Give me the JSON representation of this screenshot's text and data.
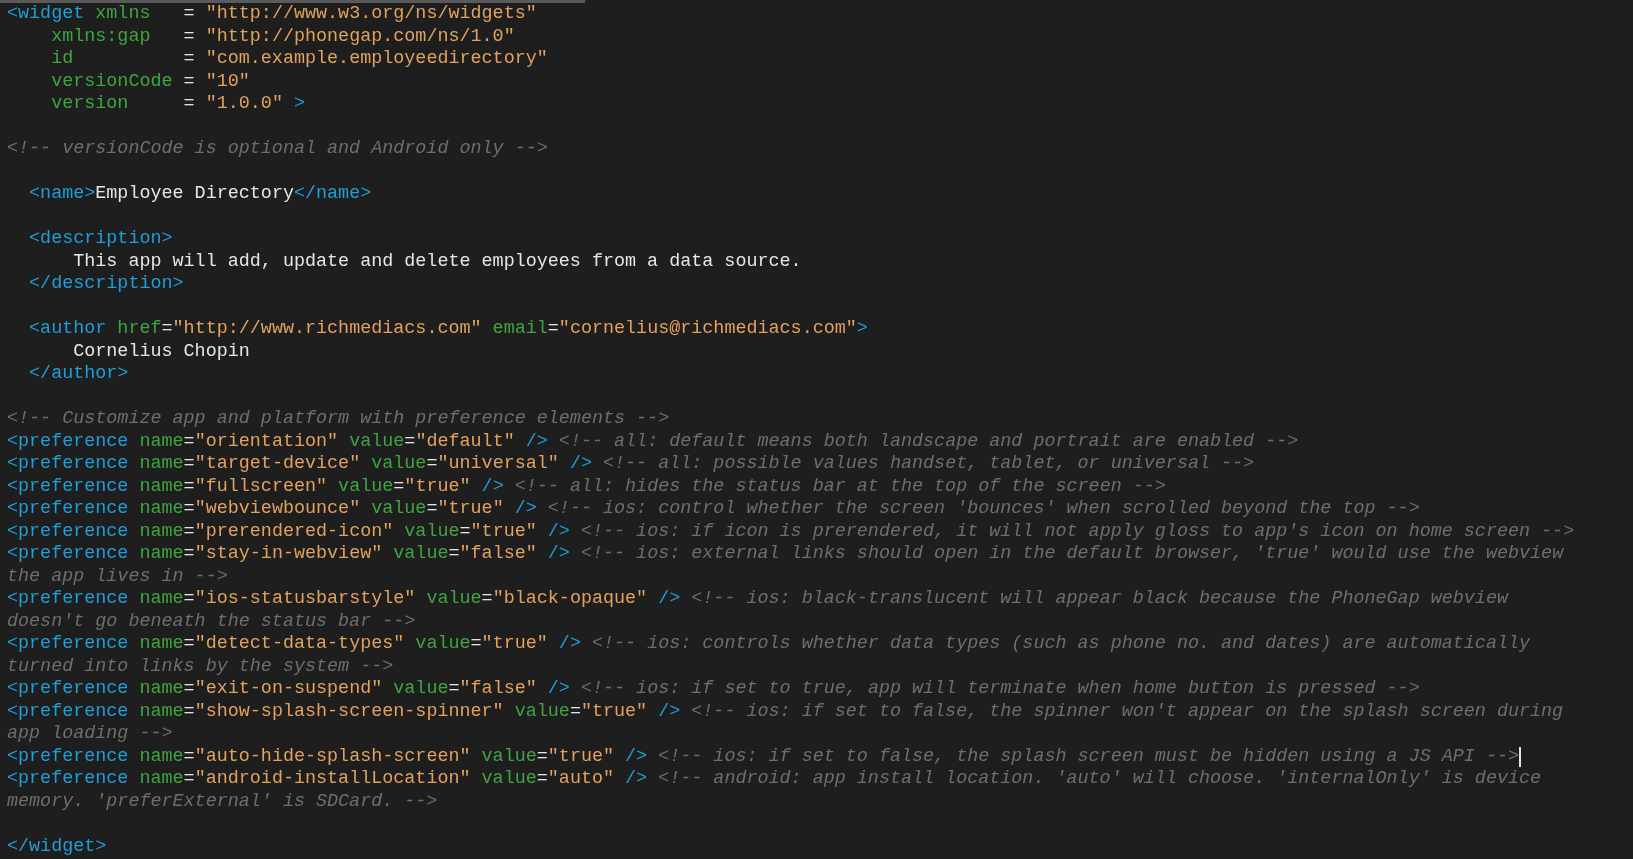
{
  "editor": {
    "lines": [
      {
        "kind": "code",
        "tokens": [
          {
            "kind": "tag",
            "text": "<widget"
          },
          {
            "kind": "attr",
            "text": " xmlns"
          },
          {
            "kind": "text",
            "text": "   = "
          },
          {
            "kind": "string",
            "text": "\"http://www.w3.org/ns/widgets\""
          }
        ]
      },
      {
        "kind": "code",
        "tokens": [
          {
            "kind": "attr",
            "text": "    xmlns:gap"
          },
          {
            "kind": "text",
            "text": "   = "
          },
          {
            "kind": "string",
            "text": "\"http://phonegap.com/ns/1.0\""
          }
        ]
      },
      {
        "kind": "code",
        "tokens": [
          {
            "kind": "attr",
            "text": "    id"
          },
          {
            "kind": "text",
            "text": "          = "
          },
          {
            "kind": "string",
            "text": "\"com.example.employeedirectory\""
          }
        ]
      },
      {
        "kind": "code",
        "tokens": [
          {
            "kind": "attr",
            "text": "    versionCode"
          },
          {
            "kind": "text",
            "text": " = "
          },
          {
            "kind": "string",
            "text": "\"10\""
          }
        ]
      },
      {
        "kind": "code",
        "tokens": [
          {
            "kind": "attr",
            "text": "    version"
          },
          {
            "kind": "text",
            "text": "     = "
          },
          {
            "kind": "string",
            "text": "\"1.0.0\""
          },
          {
            "kind": "tag",
            "text": " >"
          }
        ]
      },
      {
        "kind": "blank"
      },
      {
        "kind": "code",
        "tokens": [
          {
            "kind": "comment",
            "text": "<!-- versionCode is optional and Android only -->"
          }
        ]
      },
      {
        "kind": "blank"
      },
      {
        "kind": "code",
        "tokens": [
          {
            "kind": "tag",
            "text": "  <name>"
          },
          {
            "kind": "text",
            "text": "Employee Directory"
          },
          {
            "kind": "tag",
            "text": "</name>"
          }
        ]
      },
      {
        "kind": "blank"
      },
      {
        "kind": "code",
        "tokens": [
          {
            "kind": "tag",
            "text": "  <description>"
          }
        ]
      },
      {
        "kind": "code",
        "tokens": [
          {
            "kind": "text",
            "text": "      This app will add, update and delete employees from a data source."
          }
        ]
      },
      {
        "kind": "code",
        "tokens": [
          {
            "kind": "tag",
            "text": "  </description>"
          }
        ]
      },
      {
        "kind": "blank"
      },
      {
        "kind": "code",
        "tokens": [
          {
            "kind": "tag",
            "text": "  <author"
          },
          {
            "kind": "attr",
            "text": " href"
          },
          {
            "kind": "text",
            "text": "="
          },
          {
            "kind": "string",
            "text": "\"http://www.richmediacs.com\""
          },
          {
            "kind": "attr",
            "text": " email"
          },
          {
            "kind": "text",
            "text": "="
          },
          {
            "kind": "string",
            "text": "\"cornelius@richmediacs.com\""
          },
          {
            "kind": "tag",
            "text": ">"
          }
        ]
      },
      {
        "kind": "code",
        "tokens": [
          {
            "kind": "text",
            "text": "      Cornelius Chopin"
          }
        ]
      },
      {
        "kind": "code",
        "tokens": [
          {
            "kind": "tag",
            "text": "  </author>"
          }
        ]
      },
      {
        "kind": "blank"
      },
      {
        "kind": "code",
        "tokens": [
          {
            "kind": "comment",
            "text": "<!-- Customize app and platform with preference elements -->"
          }
        ]
      },
      {
        "kind": "code",
        "tokens": [
          {
            "kind": "tag",
            "text": "<preference"
          },
          {
            "kind": "attr",
            "text": " name"
          },
          {
            "kind": "text",
            "text": "="
          },
          {
            "kind": "string",
            "text": "\"orientation\""
          },
          {
            "kind": "attr",
            "text": " value"
          },
          {
            "kind": "text",
            "text": "="
          },
          {
            "kind": "string",
            "text": "\"default\""
          },
          {
            "kind": "tag",
            "text": " />"
          },
          {
            "kind": "comment",
            "text": " <!-- all: default means both landscape and portrait are enabled -->"
          }
        ]
      },
      {
        "kind": "code",
        "tokens": [
          {
            "kind": "tag",
            "text": "<preference"
          },
          {
            "kind": "attr",
            "text": " name"
          },
          {
            "kind": "text",
            "text": "="
          },
          {
            "kind": "string",
            "text": "\"target-device\""
          },
          {
            "kind": "attr",
            "text": " value"
          },
          {
            "kind": "text",
            "text": "="
          },
          {
            "kind": "string",
            "text": "\"universal\""
          },
          {
            "kind": "tag",
            "text": " />"
          },
          {
            "kind": "comment",
            "text": " <!-- all: possible values handset, tablet, or universal -->"
          }
        ]
      },
      {
        "kind": "code",
        "tokens": [
          {
            "kind": "tag",
            "text": "<preference"
          },
          {
            "kind": "attr",
            "text": " name"
          },
          {
            "kind": "text",
            "text": "="
          },
          {
            "kind": "string",
            "text": "\"fullscreen\""
          },
          {
            "kind": "attr",
            "text": " value"
          },
          {
            "kind": "text",
            "text": "="
          },
          {
            "kind": "string",
            "text": "\"true\""
          },
          {
            "kind": "tag",
            "text": " />"
          },
          {
            "kind": "comment",
            "text": " <!-- all: hides the status bar at the top of the screen -->"
          }
        ]
      },
      {
        "kind": "code",
        "tokens": [
          {
            "kind": "tag",
            "text": "<preference"
          },
          {
            "kind": "attr",
            "text": " name"
          },
          {
            "kind": "text",
            "text": "="
          },
          {
            "kind": "string",
            "text": "\"webviewbounce\""
          },
          {
            "kind": "attr",
            "text": " value"
          },
          {
            "kind": "text",
            "text": "="
          },
          {
            "kind": "string",
            "text": "\"true\""
          },
          {
            "kind": "tag",
            "text": " />"
          },
          {
            "kind": "comment",
            "text": " <!-- ios: control whether the screen 'bounces' when scrolled beyond the top -->"
          }
        ]
      },
      {
        "kind": "code",
        "tokens": [
          {
            "kind": "tag",
            "text": "<preference"
          },
          {
            "kind": "attr",
            "text": " name"
          },
          {
            "kind": "text",
            "text": "="
          },
          {
            "kind": "string",
            "text": "\"prerendered-icon\""
          },
          {
            "kind": "attr",
            "text": " value"
          },
          {
            "kind": "text",
            "text": "="
          },
          {
            "kind": "string",
            "text": "\"true\""
          },
          {
            "kind": "tag",
            "text": " />"
          },
          {
            "kind": "comment",
            "text": " <!-- ios: if icon is prerendered, it will not apply gloss to app's icon on home screen -->"
          }
        ]
      },
      {
        "kind": "code",
        "tokens": [
          {
            "kind": "tag",
            "text": "<preference"
          },
          {
            "kind": "attr",
            "text": " name"
          },
          {
            "kind": "text",
            "text": "="
          },
          {
            "kind": "string",
            "text": "\"stay-in-webview\""
          },
          {
            "kind": "attr",
            "text": " value"
          },
          {
            "kind": "text",
            "text": "="
          },
          {
            "kind": "string",
            "text": "\"false\""
          },
          {
            "kind": "tag",
            "text": " />"
          },
          {
            "kind": "comment",
            "text": " <!-- ios: external links should open in the default browser, 'true' would use the webview"
          }
        ]
      },
      {
        "kind": "code",
        "tokens": [
          {
            "kind": "comment",
            "text": "the app lives in -->"
          }
        ]
      },
      {
        "kind": "code",
        "tokens": [
          {
            "kind": "tag",
            "text": "<preference"
          },
          {
            "kind": "attr",
            "text": " name"
          },
          {
            "kind": "text",
            "text": "="
          },
          {
            "kind": "string",
            "text": "\"ios-statusbarstyle\""
          },
          {
            "kind": "attr",
            "text": " value"
          },
          {
            "kind": "text",
            "text": "="
          },
          {
            "kind": "string",
            "text": "\"black-opaque\""
          },
          {
            "kind": "tag",
            "text": " />"
          },
          {
            "kind": "comment",
            "text": " <!-- ios: black-translucent will appear black because the PhoneGap webview"
          }
        ]
      },
      {
        "kind": "code",
        "tokens": [
          {
            "kind": "comment",
            "text": "doesn't go beneath the status bar -->"
          }
        ]
      },
      {
        "kind": "code",
        "tokens": [
          {
            "kind": "tag",
            "text": "<preference"
          },
          {
            "kind": "attr",
            "text": " name"
          },
          {
            "kind": "text",
            "text": "="
          },
          {
            "kind": "string",
            "text": "\"detect-data-types\""
          },
          {
            "kind": "attr",
            "text": " value"
          },
          {
            "kind": "text",
            "text": "="
          },
          {
            "kind": "string",
            "text": "\"true\""
          },
          {
            "kind": "tag",
            "text": " />"
          },
          {
            "kind": "comment",
            "text": " <!-- ios: controls whether data types (such as phone no. and dates) are automatically"
          }
        ]
      },
      {
        "kind": "code",
        "tokens": [
          {
            "kind": "comment",
            "text": "turned into links by the system -->"
          }
        ]
      },
      {
        "kind": "code",
        "tokens": [
          {
            "kind": "tag",
            "text": "<preference"
          },
          {
            "kind": "attr",
            "text": " name"
          },
          {
            "kind": "text",
            "text": "="
          },
          {
            "kind": "string",
            "text": "\"exit-on-suspend\""
          },
          {
            "kind": "attr",
            "text": " value"
          },
          {
            "kind": "text",
            "text": "="
          },
          {
            "kind": "string",
            "text": "\"false\""
          },
          {
            "kind": "tag",
            "text": " />"
          },
          {
            "kind": "comment",
            "text": " <!-- ios: if set to true, app will terminate when home button is pressed -->"
          }
        ]
      },
      {
        "kind": "code",
        "tokens": [
          {
            "kind": "tag",
            "text": "<preference"
          },
          {
            "kind": "attr",
            "text": " name"
          },
          {
            "kind": "text",
            "text": "="
          },
          {
            "kind": "string",
            "text": "\"show-splash-screen-spinner\""
          },
          {
            "kind": "attr",
            "text": " value"
          },
          {
            "kind": "text",
            "text": "="
          },
          {
            "kind": "string",
            "text": "\"true\""
          },
          {
            "kind": "tag",
            "text": " />"
          },
          {
            "kind": "comment",
            "text": " <!-- ios: if set to false, the spinner won't appear on the splash screen during"
          }
        ]
      },
      {
        "kind": "code",
        "tokens": [
          {
            "kind": "comment",
            "text": "app loading -->"
          }
        ]
      },
      {
        "kind": "code",
        "cursor": true,
        "tokens": [
          {
            "kind": "tag",
            "text": "<preference"
          },
          {
            "kind": "attr",
            "text": " name"
          },
          {
            "kind": "text",
            "text": "="
          },
          {
            "kind": "string",
            "text": "\"auto-hide-splash-screen\""
          },
          {
            "kind": "attr",
            "text": " value"
          },
          {
            "kind": "text",
            "text": "="
          },
          {
            "kind": "string",
            "text": "\"true\""
          },
          {
            "kind": "tag",
            "text": " />"
          },
          {
            "kind": "comment",
            "text": " <!-- ios: if set to false, the splash screen must be hidden using a JS API -->"
          }
        ]
      },
      {
        "kind": "code",
        "tokens": [
          {
            "kind": "tag",
            "text": "<preference"
          },
          {
            "kind": "attr",
            "text": " name"
          },
          {
            "kind": "text",
            "text": "="
          },
          {
            "kind": "string",
            "text": "\"android-installLocation\""
          },
          {
            "kind": "attr",
            "text": " value"
          },
          {
            "kind": "text",
            "text": "="
          },
          {
            "kind": "string",
            "text": "\"auto\""
          },
          {
            "kind": "tag",
            "text": " />"
          },
          {
            "kind": "comment",
            "text": " <!-- android: app install location. 'auto' will choose. 'internalOnly' is device"
          }
        ]
      },
      {
        "kind": "code",
        "tokens": [
          {
            "kind": "comment",
            "text": "memory. 'preferExternal' is SDCard. -->"
          }
        ]
      },
      {
        "kind": "blank"
      },
      {
        "kind": "code",
        "tokens": [
          {
            "kind": "tag",
            "text": "</widget>"
          }
        ]
      }
    ]
  }
}
